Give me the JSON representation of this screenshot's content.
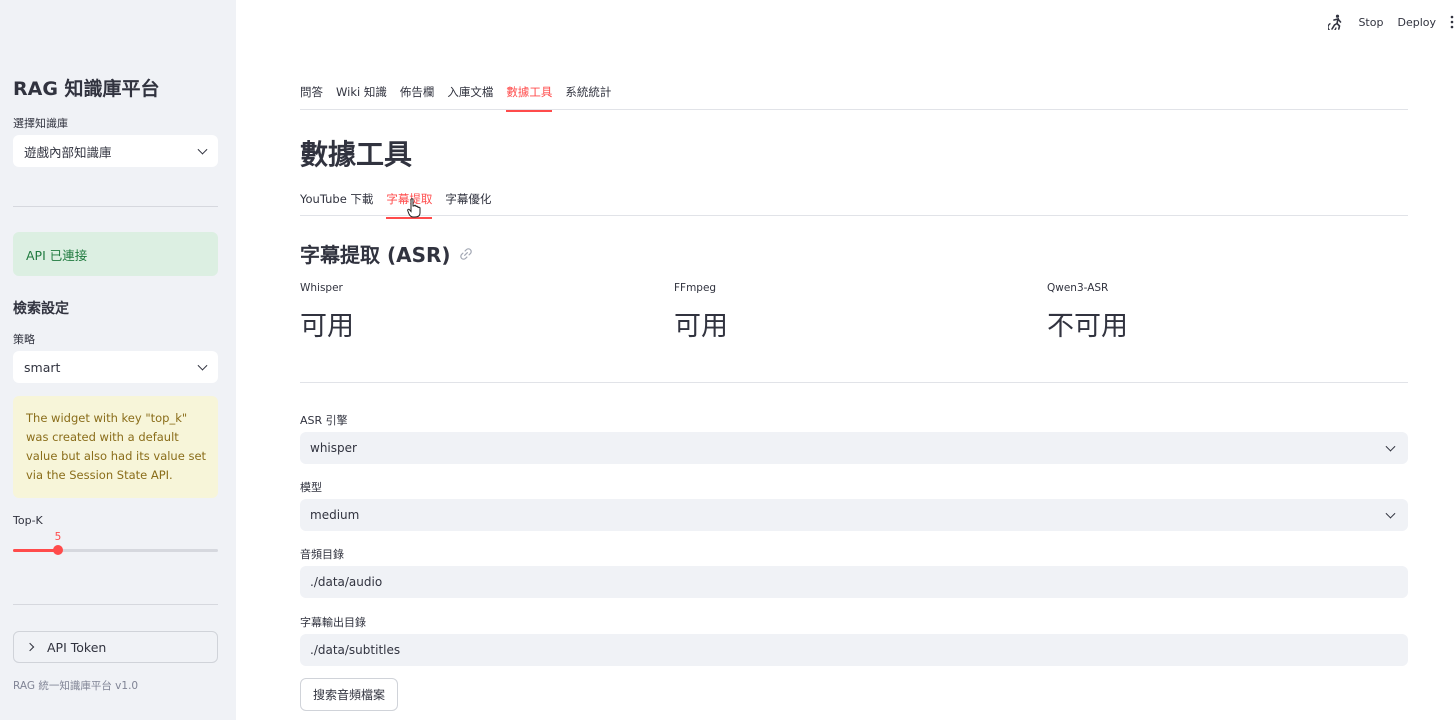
{
  "header": {
    "stop_label": "Stop",
    "deploy_label": "Deploy",
    "run_icon": "running-person-icon",
    "menu_icon": "vertical-dots-icon"
  },
  "sidebar": {
    "title": "RAG 知識庫平台",
    "kb_label": "選擇知識庫",
    "kb_value": "遊戲內部知識庫",
    "api_status": "API 已連接",
    "search_heading": "檢索設定",
    "strategy_label": "策略",
    "strategy_value": "smart",
    "warning": "The widget with key \"top_k\" was created with a default value but also had its value set via the Session State API.",
    "topk_label": "Top-K",
    "topk_value": "5",
    "topk_fraction": 0.22,
    "token_label": "API Token",
    "version": "RAG 統一知識庫平台 v1.0"
  },
  "main": {
    "tabs": [
      {
        "label": "問答"
      },
      {
        "label": "Wiki 知識"
      },
      {
        "label": "佈告欄"
      },
      {
        "label": "入庫文檔"
      },
      {
        "label": "數據工具",
        "active": true
      },
      {
        "label": "系統統計"
      }
    ],
    "page_title": "數據工具",
    "subtabs": [
      {
        "label": "YouTube 下載"
      },
      {
        "label": "字幕提取",
        "active": true
      },
      {
        "label": "字幕優化"
      }
    ],
    "section_title": "字幕提取 (ASR)",
    "metrics": [
      {
        "label": "Whisper",
        "value": "可用"
      },
      {
        "label": "FFmpeg",
        "value": "可用"
      },
      {
        "label": "Qwen3-ASR",
        "value": "不可用"
      }
    ],
    "asr_engine_label": "ASR 引擎",
    "asr_engine_value": "whisper",
    "model_label": "模型",
    "model_value": "medium",
    "audio_dir_label": "音頻目錄",
    "audio_dir_value": "./data/audio",
    "subtitle_dir_label": "字幕輸出目錄",
    "subtitle_dir_value": "./data/subtitles",
    "search_button": "搜索音頻檔案"
  },
  "colors": {
    "accent": "#ff4b4b",
    "sidebar_bg": "#f0f2f6",
    "success_bg": "#dcefe2",
    "warning_bg": "#f7f5d9"
  }
}
